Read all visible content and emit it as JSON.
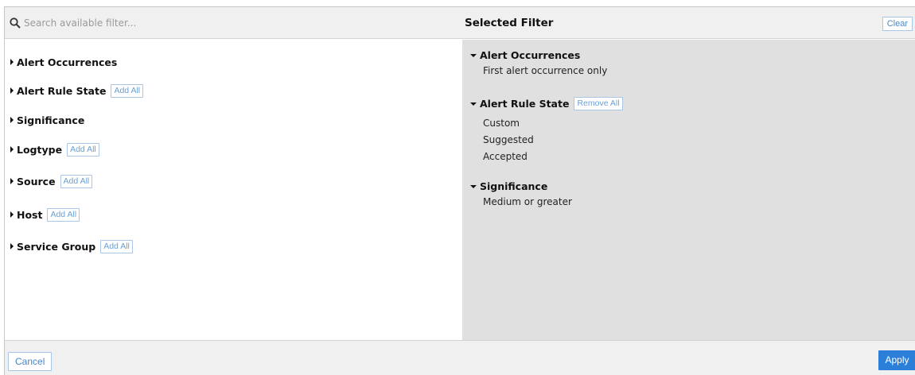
{
  "header": {
    "search_placeholder": "Search available filter...",
    "selected_title": "Selected Filter",
    "clear_label": "Clear"
  },
  "available": {
    "items": [
      {
        "label": "Alert Occurrences",
        "add_label": ""
      },
      {
        "label": "Alert Rule State",
        "add_label": "Add All"
      },
      {
        "label": "Significance",
        "add_label": ""
      },
      {
        "label": "Logtype",
        "add_label": "Add All"
      },
      {
        "label": "Source",
        "add_label": "Add All"
      },
      {
        "label": "Host",
        "add_label": "Add All"
      },
      {
        "label": "Service Group",
        "add_label": "Add All"
      }
    ]
  },
  "selected": {
    "groups": [
      {
        "label": "Alert Occurrences",
        "values": [
          "First alert occurrence only"
        ]
      },
      {
        "label": "Alert Rule State",
        "remove_label": "Remove All",
        "values": [
          "Custom",
          "Suggested",
          "Accepted"
        ]
      },
      {
        "label": "Significance",
        "values": [
          "Medium or greater"
        ]
      }
    ]
  },
  "footer": {
    "cancel_label": "Cancel",
    "apply_label": "Apply"
  },
  "colors": {
    "accent": "#2b7fd9",
    "link": "#4a86c5",
    "panel_gray": "#e0e0e0",
    "bar_gray": "#f0f0f0"
  }
}
